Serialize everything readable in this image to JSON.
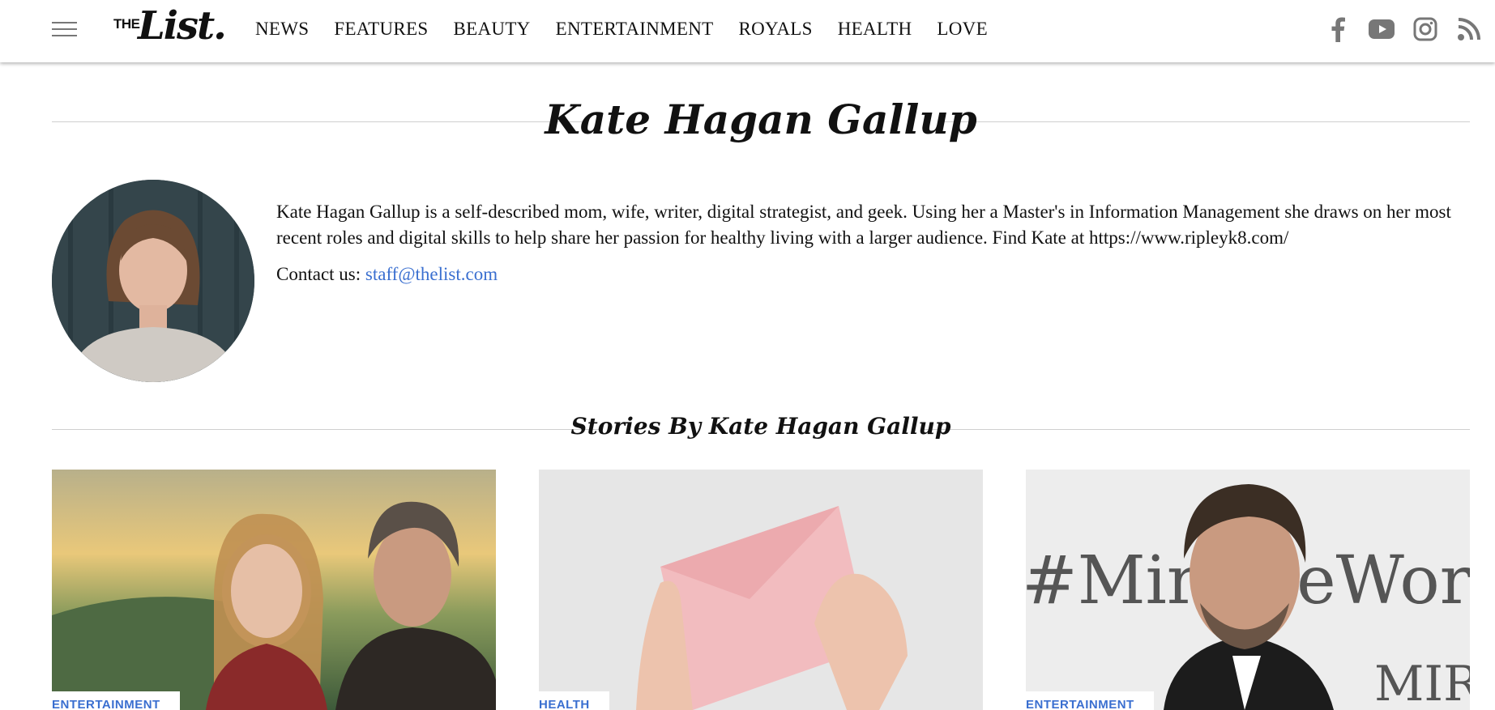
{
  "header": {
    "logo_the": "THE",
    "logo_list": "List.",
    "nav": [
      "NEWS",
      "FEATURES",
      "BEAUTY",
      "ENTERTAINMENT",
      "ROYALS",
      "HEALTH",
      "LOVE"
    ],
    "social_icons": [
      "facebook-icon",
      "youtube-icon",
      "instagram-icon",
      "rss-icon"
    ]
  },
  "author": {
    "name": "Kate Hagan Gallup",
    "bio": "Kate Hagan Gallup is a self-described mom, wife, writer, digital strategist, and geek. Using her a Master's in Information Management she draws on her most recent roles and digital skills to help share her passion for healthy living with a larger audience. Find Kate at https://www.ripleyk8.com/",
    "contact_label": "Contact us:",
    "contact_email": "staff@thelist.com"
  },
  "stories": {
    "heading": "Stories By Kate Hagan Gallup",
    "cards": [
      {
        "tag": "ENTERTAINMENT"
      },
      {
        "tag": "HEALTH"
      },
      {
        "tag": "ENTERTAINMENT"
      }
    ]
  },
  "colors": {
    "link": "#3a6fd0",
    "icon_gray": "#777777",
    "divider": "#cfcfcf"
  }
}
